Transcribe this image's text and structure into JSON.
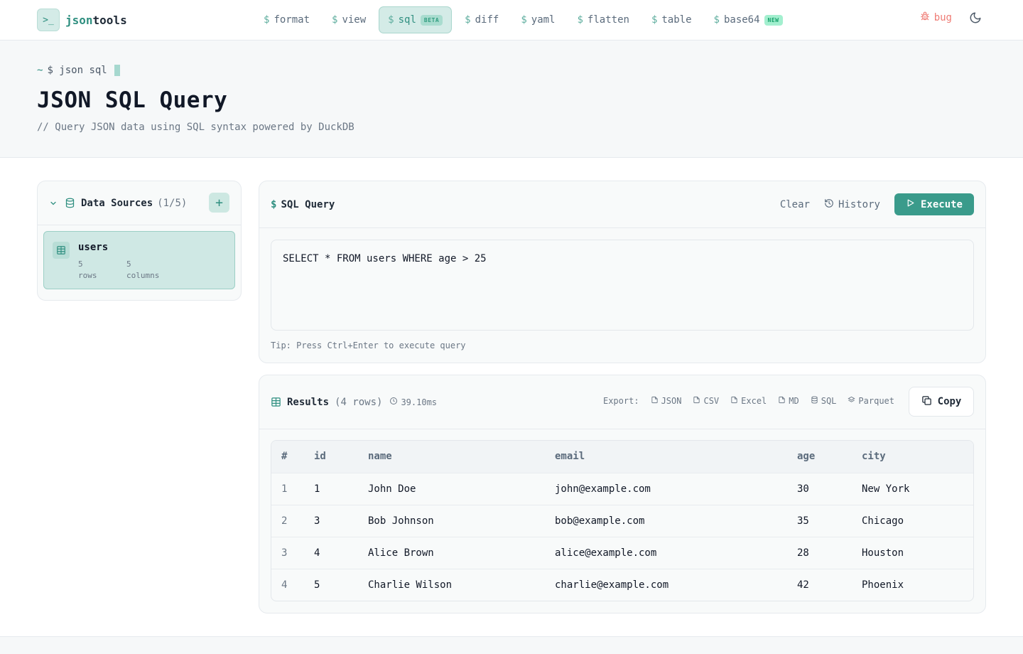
{
  "app": {
    "logo_prefix": "json",
    "logo_suffix": "tools",
    "logo_icon": ">_"
  },
  "nav": [
    {
      "label": "format",
      "active": false,
      "badge": ""
    },
    {
      "label": "view",
      "active": false,
      "badge": ""
    },
    {
      "label": "sql",
      "active": true,
      "badge": "BETA"
    },
    {
      "label": "diff",
      "active": false,
      "badge": ""
    },
    {
      "label": "yaml",
      "active": false,
      "badge": ""
    },
    {
      "label": "flatten",
      "active": false,
      "badge": ""
    },
    {
      "label": "table",
      "active": false,
      "badge": ""
    },
    {
      "label": "base64",
      "active": false,
      "badge": "NEW"
    }
  ],
  "nav_prefix": "$",
  "top_right": {
    "bug_label": "bug",
    "theme_icon": "moon-icon"
  },
  "hero": {
    "prompt_tilde": "~",
    "prompt_cmd": "$ json sql",
    "title": "JSON SQL Query",
    "subtitle": "// Query JSON data using SQL syntax powered by DuckDB"
  },
  "sidebar": {
    "title": "Data Sources",
    "count": "(1/5)",
    "add_label": "+",
    "sources": [
      {
        "name": "users",
        "rows_value": "5",
        "rows_label": "rows",
        "cols_value": "5",
        "cols_label": "columns"
      }
    ]
  },
  "query": {
    "title_prefix": "$",
    "title": "SQL Query",
    "clear_label": "Clear",
    "history_label": "History",
    "execute_label": "Execute",
    "sql": "SELECT * FROM users WHERE age > 25",
    "tip": "Tip: Press Ctrl+Enter to execute query"
  },
  "results": {
    "title": "Results",
    "rows": "(4 rows)",
    "time": "39.10ms",
    "export_label": "Export:",
    "exports": [
      "JSON",
      "CSV",
      "Excel",
      "MD",
      "SQL",
      "Parquet"
    ],
    "copy_label": "Copy",
    "columns": [
      "#",
      "id",
      "name",
      "email",
      "age",
      "city"
    ],
    "data": [
      [
        "1",
        "1",
        "John Doe",
        "john@example.com",
        "30",
        "New York"
      ],
      [
        "2",
        "3",
        "Bob Johnson",
        "bob@example.com",
        "35",
        "Chicago"
      ],
      [
        "3",
        "4",
        "Alice Brown",
        "alice@example.com",
        "28",
        "Houston"
      ],
      [
        "4",
        "5",
        "Charlie Wilson",
        "charlie@example.com",
        "42",
        "Phoenix"
      ]
    ]
  },
  "colors": {
    "accent": "#2f8f80",
    "execute": "#3a9b8b",
    "bug": "#ef7b74"
  }
}
